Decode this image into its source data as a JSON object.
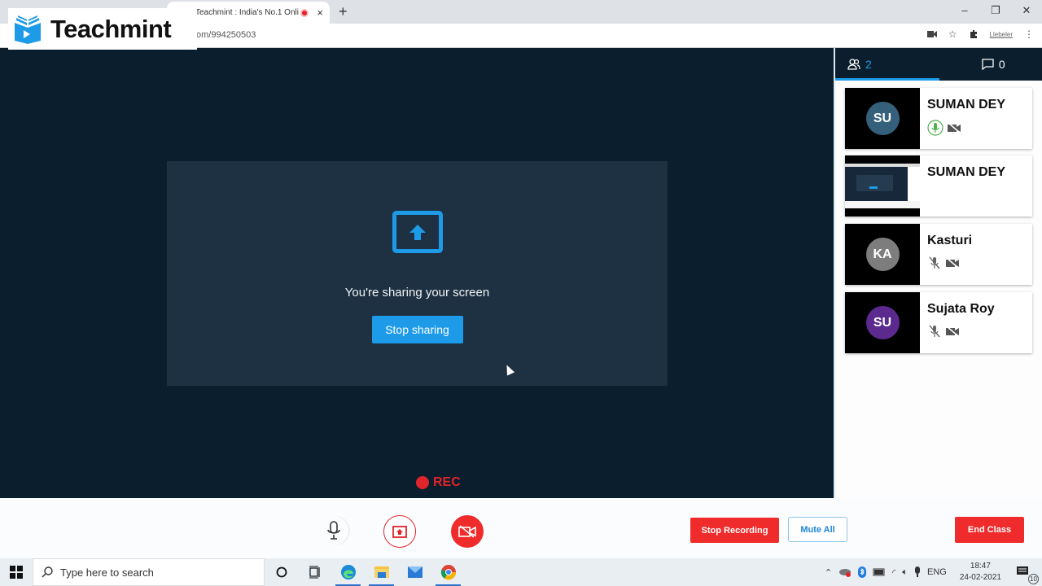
{
  "browser": {
    "tab_title": "Teachmint : India's No.1 Onli",
    "url": "om/994250503",
    "new_tab_label": "+",
    "tab_close_label": "×",
    "window_controls": {
      "minimize": "–",
      "maximize": "❐",
      "close": "✕"
    },
    "extension_label": "Llebeler"
  },
  "logo": {
    "text": "Teachmint",
    "color": "#1d9be8"
  },
  "stage": {
    "share_message": "You're sharing your screen",
    "stop_sharing_label": "Stop sharing",
    "rec_label": "REC"
  },
  "sidebar": {
    "tabs": [
      {
        "icon": "participants-icon",
        "count": "2",
        "active": true
      },
      {
        "icon": "chat-icon",
        "count": "0",
        "active": false
      }
    ],
    "participants": [
      {
        "initials": "SU",
        "name": "SUMAN DEY",
        "avatar_color": "#35607c",
        "mic": "on",
        "camera": "off",
        "video": "avatar"
      },
      {
        "initials": "",
        "name": "SUMAN DEY",
        "avatar_color": "",
        "mic": "none",
        "camera": "none",
        "video": "screen-share"
      },
      {
        "initials": "KA",
        "name": "Kasturi",
        "avatar_color": "#7d7d7d",
        "mic": "off",
        "camera": "off",
        "video": "avatar"
      },
      {
        "initials": "SU",
        "name": "Sujata Roy",
        "avatar_color": "#5c2a8f",
        "mic": "off",
        "camera": "off",
        "video": "avatar"
      }
    ]
  },
  "controls": {
    "stop_recording_label": "Stop Recording",
    "mute_all_label": "Mute All",
    "end_class_label": "End Class"
  },
  "taskbar": {
    "search_placeholder": "Type here to search",
    "language": "ENG",
    "time": "18:47",
    "date": "24-02-2021",
    "notification_count": "10"
  },
  "colors": {
    "accent": "#1d9be8",
    "danger": "#ef2b2b",
    "stage_bg": "#0b1e2d",
    "panel_bg": "#1e3142"
  }
}
